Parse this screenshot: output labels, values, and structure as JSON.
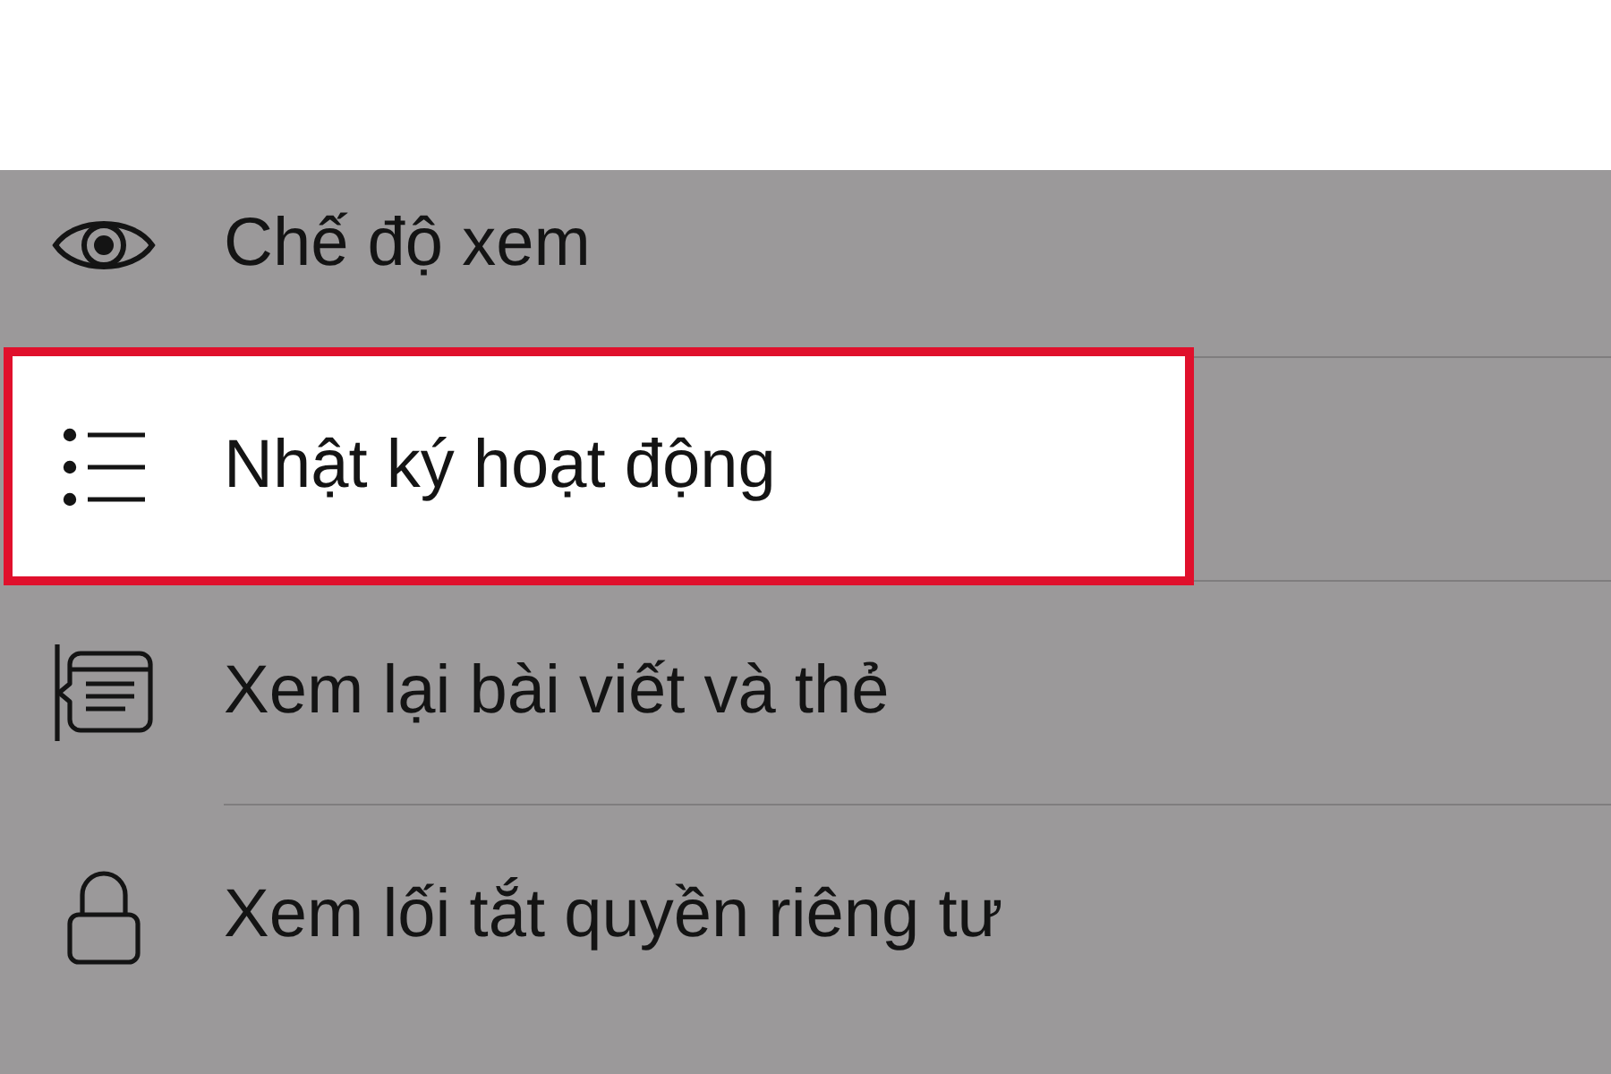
{
  "menu": {
    "items": [
      {
        "label": "Chế độ xem",
        "highlighted": false
      },
      {
        "label": "Nhật ký hoạt động",
        "highlighted": true
      },
      {
        "label": "Xem lại bài viết và thẻ",
        "highlighted": false
      },
      {
        "label": "Xem lối tắt quyền riêng tư",
        "highlighted": false
      }
    ]
  }
}
